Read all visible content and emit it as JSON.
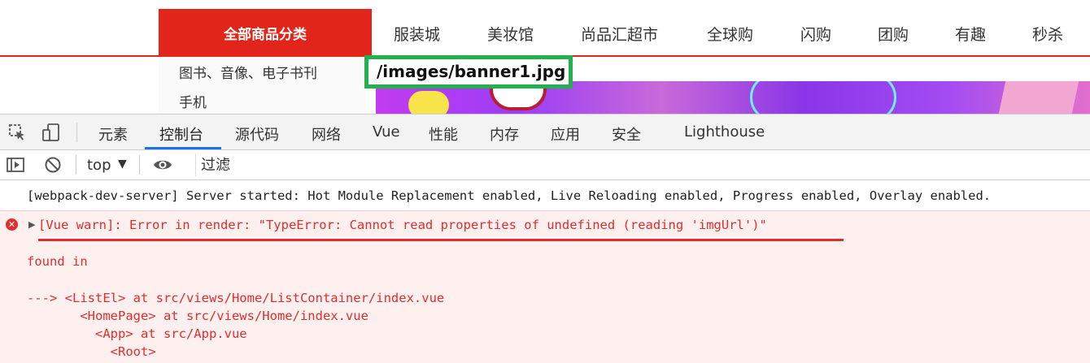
{
  "site": {
    "all_categories": "全部商品分类",
    "nav_links": [
      "服装城",
      "美妆馆",
      "尚品汇超市",
      "全球购",
      "闪购",
      "团购",
      "有趣",
      "秒杀"
    ],
    "category_items": [
      "图书、音像、电子书刊",
      "手机"
    ],
    "image_path_annotation": "/images/banner1.jpg"
  },
  "devtools": {
    "tabs": [
      "元素",
      "控制台",
      "源代码",
      "网络",
      "Vue",
      "性能",
      "内存",
      "应用",
      "安全",
      "Lighthouse"
    ],
    "active_tab": "控制台",
    "context": "top",
    "filter_placeholder": "过滤",
    "icons": [
      "inspect-element-icon",
      "device-toolbar-icon",
      "sidebar-toggle-icon",
      "clear-console-icon",
      "eye-icon"
    ]
  },
  "console": {
    "log_message": "[webpack-dev-server] Server started: Hot Module Replacement enabled, Live Reloading enabled, Progress enabled, Overlay enabled.",
    "error_message": "[Vue warn]: Error in render: \"TypeError: Cannot read properties of undefined (reading 'imgUrl')\"",
    "found_in": "found in",
    "trace": [
      "---> <ListEl> at src/views/Home/ListContainer/index.vue",
      "       <HomePage> at src/views/Home/index.vue",
      "         <App> at src/App.vue",
      "           <Root>"
    ]
  },
  "colors": {
    "brand_red": "#e1251b",
    "highlight_green": "#23b14d",
    "error_red": "#e02d2d",
    "devtools_blue": "#1a73e8"
  }
}
